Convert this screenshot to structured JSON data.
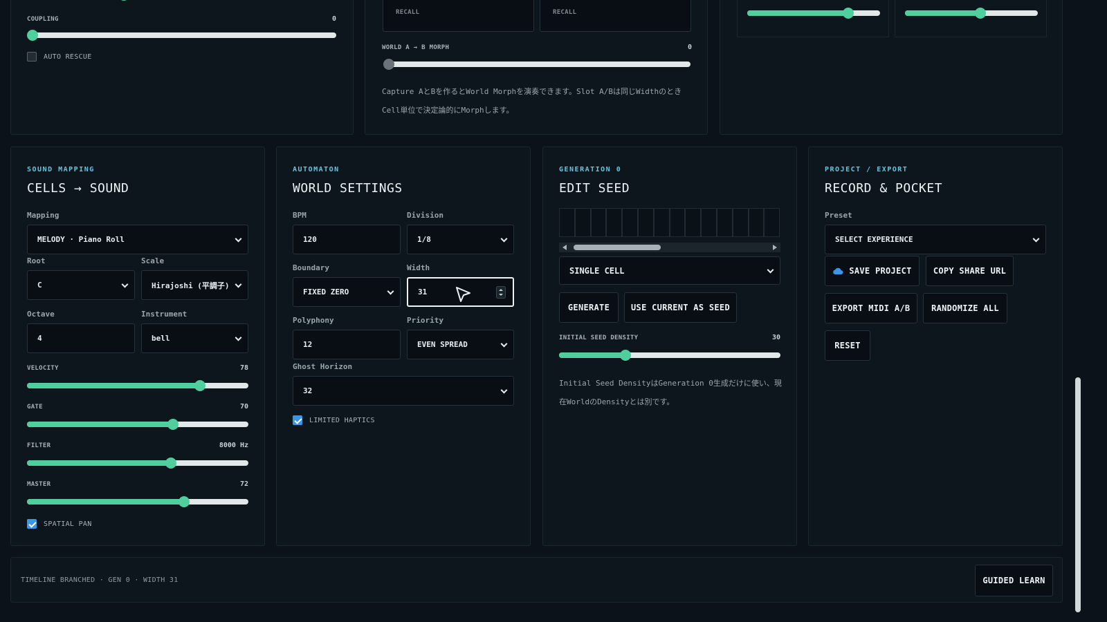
{
  "top_left": {
    "coupling": {
      "label": "COUPLING",
      "value": "0",
      "level": 0
    },
    "auto_rescue": {
      "label": "AUTO RESCUE",
      "checked": false
    }
  },
  "top_mid": {
    "recall_a": "RECALL",
    "recall_b": "RECALL",
    "morph": {
      "label": "WORLD A → B MORPH",
      "value": "0",
      "level": 0
    },
    "note": "Capture AとBを作るとWorld Morphを演奏できます。Slot A/Bは同じWidthのときCell単位で決定論的にMorphします。"
  },
  "top_right": {
    "slider_a_level": 0.76,
    "slider_b_level": 0.57
  },
  "sound": {
    "eyebrow": "SOUND MAPPING",
    "title": "CELLS → SOUND",
    "mapping_label": "Mapping",
    "mapping_value": "MELODY · Piano Roll",
    "root_label": "Root",
    "root_value": "C",
    "scale_label": "Scale",
    "scale_value": "Hirajoshi (平調子)",
    "octave_label": "Octave",
    "octave_value": "4",
    "instrument_label": "Instrument",
    "instrument_value": "bell",
    "velocity": {
      "label": "VELOCITY",
      "value": "78",
      "level": 0.78
    },
    "gate": {
      "label": "GATE",
      "value": "70",
      "level": 0.66
    },
    "filter": {
      "label": "FILTER",
      "value": "8000 Hz",
      "level": 0.65
    },
    "master": {
      "label": "MASTER",
      "value": "72",
      "level": 0.71
    },
    "spatial_pan": {
      "label": "SPATIAL PAN",
      "checked": true
    }
  },
  "world": {
    "eyebrow": "AUTOMATON",
    "title": "WORLD SETTINGS",
    "bpm_label": "BPM",
    "bpm_value": "120",
    "division_label": "Division",
    "division_value": "1/8",
    "boundary_label": "Boundary",
    "boundary_value": "FIXED ZERO",
    "width_label": "Width",
    "width_value": "31",
    "polyphony_label": "Polyphony",
    "polyphony_value": "12",
    "priority_label": "Priority",
    "priority_value": "EVEN SPREAD",
    "ghost_label": "Ghost Horizon",
    "ghost_value": "32",
    "haptics": {
      "label": "LIMITED HAPTICS",
      "checked": true
    }
  },
  "seed": {
    "eyebrow": "GENERATION 0",
    "title": "EDIT SEED",
    "cell_count": 14,
    "brush_value": "SINGLE CELL",
    "generate_label": "GENERATE",
    "use_current_label": "USE CURRENT AS SEED",
    "density": {
      "label": "INITIAL SEED DENSITY",
      "value": "30",
      "level": 0.3
    },
    "note": "Initial Seed DensityはGeneration 0生成だけに使い、現在WorldのDensityとは別です。"
  },
  "project": {
    "eyebrow": "PROJECT / EXPORT",
    "title": "RECORD & POCKET",
    "preset_label": "Preset",
    "preset_value": "SELECT EXPERIENCE",
    "save_label": "SAVE PROJECT",
    "copy_label": "COPY SHARE URL",
    "export_label": "EXPORT MIDI A/B",
    "randomize_label": "RANDOMIZE ALL",
    "reset_label": "RESET"
  },
  "footer": {
    "status": "TIMELINE BRANCHED · GEN 0 · WIDTH 31",
    "guided_label": "GUIDED LEARN"
  },
  "colors": {
    "accent": "#4fcf9d",
    "eyebrow": "#63c6e0",
    "checkbox": "#3a97e8",
    "background": "#0b1219"
  }
}
